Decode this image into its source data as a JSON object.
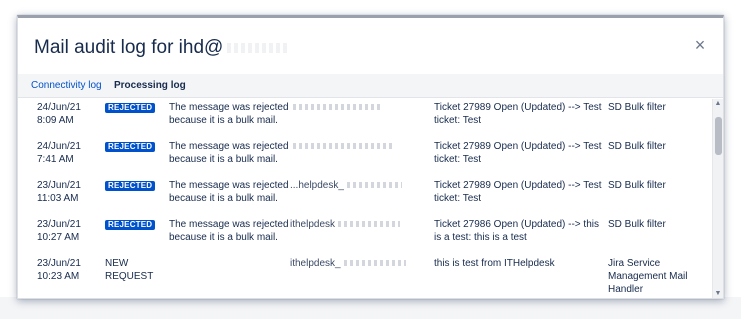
{
  "dialog": {
    "title": "Mail audit log for ihd@",
    "close_glyph": "×"
  },
  "tabs": [
    {
      "label": "Connectivity log",
      "active": false
    },
    {
      "label": "Processing log",
      "active": true
    }
  ],
  "rows": [
    {
      "date": "24/Jun/21",
      "time": "8:09 AM",
      "status": "REJECTED",
      "message": "The message was rejected because it is a bulk mail.",
      "address": "",
      "result": "Ticket 27989 Open (Updated) --> Test ticket: Test",
      "handler": "SD Bulk filter"
    },
    {
      "date": "24/Jun/21",
      "time": "7:41 AM",
      "status": "REJECTED",
      "message": "The message was rejected because it is a bulk mail.",
      "address": "",
      "result": "Ticket 27989 Open (Updated) --> Test ticket: Test",
      "handler": "SD Bulk filter"
    },
    {
      "date": "23/Jun/21",
      "time": "11:03 AM",
      "status": "REJECTED",
      "message": "The message was rejected because it is a bulk mail.",
      "address": "...helpdesk_",
      "result": "Ticket 27989 Open (Updated) --> Test ticket: Test",
      "handler": "SD Bulk filter"
    },
    {
      "date": "23/Jun/21",
      "time": "10:27 AM",
      "status": "REJECTED",
      "message": "The message was rejected because it is a bulk mail.",
      "address": "ithelpdesk",
      "result": "Ticket 27986 Open (Updated) --> this is a test: this is a test",
      "handler": "SD Bulk filter"
    },
    {
      "date": "23/Jun/21",
      "time": "10:23 AM",
      "status": "NEW REQUEST",
      "message": "",
      "address": "ithelpdesk_",
      "result": "this is test from ITHelpdesk",
      "handler": "Jira Service Management Mail Handler"
    }
  ],
  "scrollbar": {
    "up_glyph": "▲",
    "down_glyph": "▼"
  },
  "colors": {
    "lozenge": "#0052cc",
    "link": "#0052cc",
    "text": "#172b4d"
  }
}
